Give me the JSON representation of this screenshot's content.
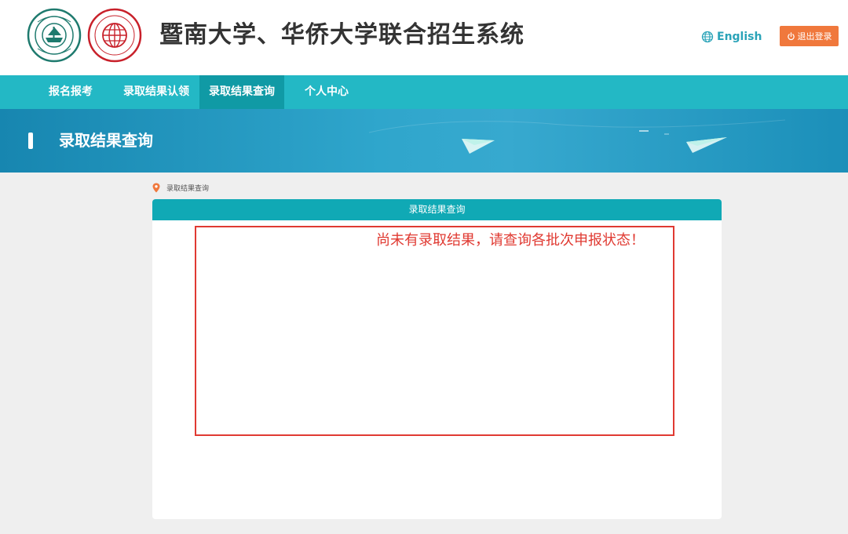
{
  "header": {
    "title": "暨南大学、华侨大学联合招生系统",
    "logo_left": "jnu-logo",
    "logo_left_text": "暨南大学 JINAN UNIVERSITY 1906",
    "logo_right": "hqu-logo",
    "logo_right_text": "HUAQIAO UNIVERSITY 華僑大學",
    "language_label": "English",
    "language_icon": "globe-icon",
    "logout_label": "退出登录",
    "logout_icon": "power-icon"
  },
  "nav": {
    "items": [
      {
        "label": "报名报考",
        "active": false
      },
      {
        "label": "录取结果认领",
        "active": false
      },
      {
        "label": "录取结果查询",
        "active": true
      },
      {
        "label": "个人中心",
        "active": false
      }
    ]
  },
  "banner": {
    "title": "录取结果查询",
    "decoration_icon": "paper-plane-icon"
  },
  "breadcrumb": {
    "icon": "location-pin-icon",
    "text": "录取结果查询"
  },
  "panel": {
    "header": "录取结果查询",
    "message": "尚未有录取结果，请查询各批次申报状态！"
  },
  "colors": {
    "nav_bg": "#23b8c5",
    "nav_active": "#109aa5",
    "logout_bg": "#f0783c",
    "notice_red": "#e03a32",
    "panel_header": "#10a9b5"
  }
}
